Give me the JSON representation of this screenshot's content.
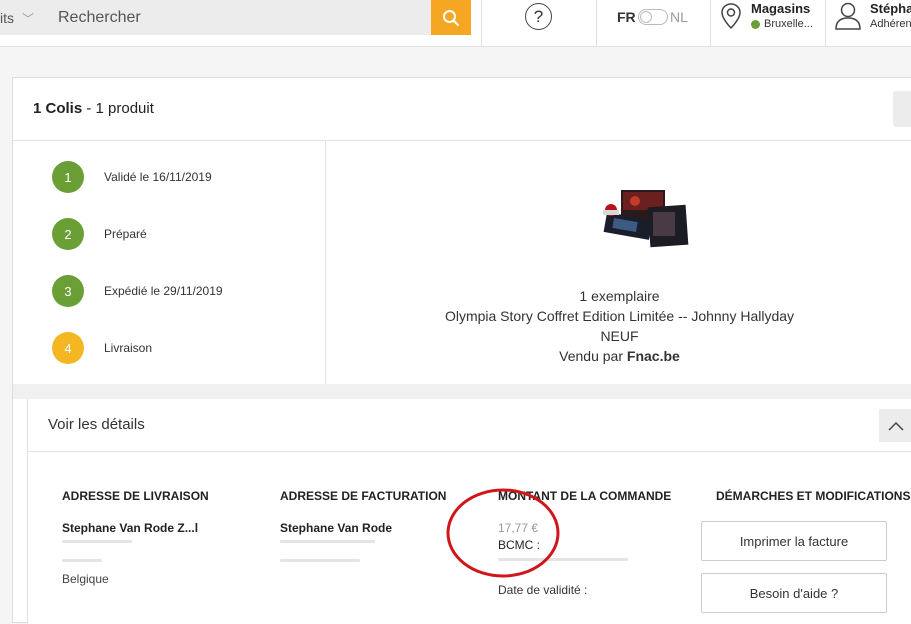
{
  "header": {
    "category_label": "its",
    "search_placeholder": "Rechercher",
    "help_symbol": "?",
    "lang_active": "FR",
    "lang_inactive": "NL",
    "stores_title": "Magasins",
    "stores_location": "Bruxelle...",
    "user_name": "Stépha",
    "user_status": "Adhéren"
  },
  "colis": {
    "count_label": "1 Colis",
    "products_label": " - 1 produit"
  },
  "steps": [
    {
      "num": "1",
      "label": "Validé le 16/11/2019",
      "color": "#6a9f35"
    },
    {
      "num": "2",
      "label": "Préparé",
      "color": "#6a9f35"
    },
    {
      "num": "3",
      "label": "Expédié le 29/11/2019",
      "color": "#6a9f35"
    },
    {
      "num": "4",
      "label": "Livraison",
      "color": "#f5b623"
    }
  ],
  "product": {
    "quantity": "1 exemplaire",
    "title": "Olympia Story Coffret Edition Limitée -- Johnny Hallyday",
    "condition": "NEUF",
    "sold_by_prefix": "Vendu par ",
    "seller": "Fnac.be"
  },
  "details": {
    "title": "Voir les détails",
    "delivery": {
      "heading": "ADRESSE DE LIVRAISON",
      "name": "Stephane Van Rode Z...l",
      "country": "Belgique"
    },
    "billing": {
      "heading": "ADRESSE DE FACTURATION",
      "name": "Stephane Van Rode"
    },
    "amount": {
      "heading": "MONTANT DE LA COMMANDE",
      "price": "17,77 €",
      "payment": "BCMC :",
      "validity": "Date de validité :"
    },
    "actions": {
      "heading": "DÉMARCHES ET MODIFICATIONS",
      "print_invoice": "Imprimer la facture",
      "need_help": "Besoin d'aide ?"
    }
  },
  "colors": {
    "accent": "#f5a623",
    "step_done": "#6a9f35",
    "step_pending": "#f5b623",
    "annotation": "#d0161b"
  }
}
